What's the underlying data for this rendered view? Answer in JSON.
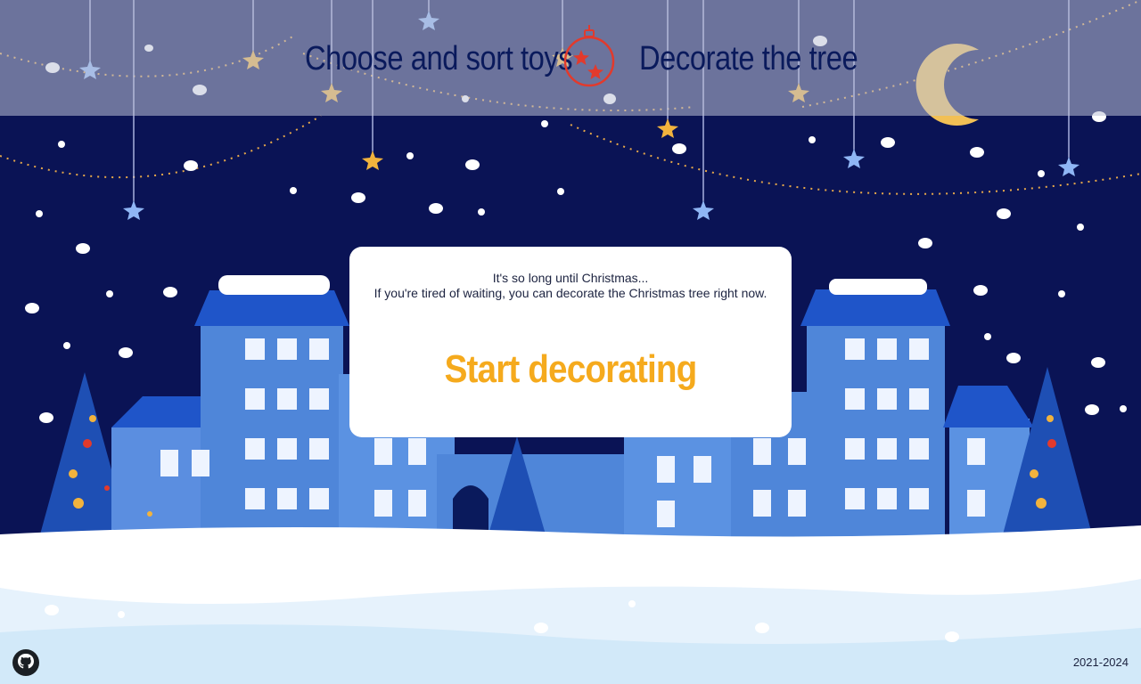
{
  "nav": {
    "toys_label": "Choose and sort toys",
    "tree_label": "Decorate the tree",
    "logo_icon": "ornament-logo-icon"
  },
  "modal": {
    "line1": "It's so long until Christmas...",
    "line2": "If you're tired of waiting, you can decorate the Christmas tree right now.",
    "start_label": "Start decorating"
  },
  "footer": {
    "github_icon": "github-icon",
    "copyright": "2021-2024"
  },
  "colors": {
    "night_sky": "#0a1355",
    "accent": "#f5aa1d",
    "nav_text": "#0a1a5c",
    "logo": "#e23a2c"
  }
}
